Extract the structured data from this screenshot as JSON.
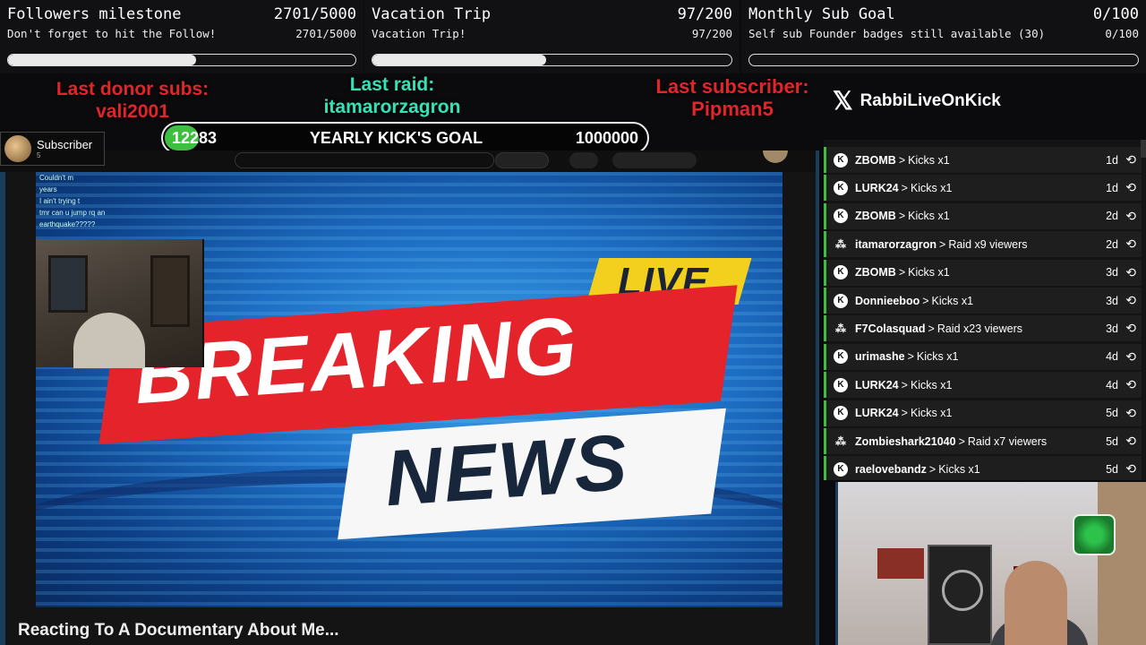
{
  "goals": [
    {
      "title": "Followers milestone",
      "count": "2701/5000",
      "subtitle": "Don't forget to hit the Follow!",
      "sub_count": "2701/5000",
      "progress": 0.54
    },
    {
      "title": "Vacation Trip",
      "count": "97/200",
      "subtitle": "Vacation Trip!",
      "sub_count": "97/200",
      "progress": 0.485
    },
    {
      "title": "Monthly Sub Goal",
      "count": "0/100",
      "subtitle": "Self sub Founder badges still available (30)",
      "sub_count": "0/100",
      "progress": 0.0
    }
  ],
  "last_donor": {
    "label": "Last donor subs:",
    "name": "vali2001"
  },
  "last_raid": {
    "label": "Last raid:",
    "name": "itamarorzagron"
  },
  "last_subscriber": {
    "label": "Last subscriber:",
    "name": "Pipman5"
  },
  "twitter": {
    "icon": "x-logo-icon",
    "handle": "RabbiLiveOnKick"
  },
  "yearly_goal": {
    "current": "12283",
    "label": "YEARLY KICK'S GOAL",
    "target": "1000000",
    "progress": 0.012
  },
  "subscriber_alert": {
    "label": "Subscriber",
    "count": "5"
  },
  "video": {
    "title": "Reacting To A Documentary About Me...",
    "banner_live": "LIVE",
    "banner_breaking": "BREAKING",
    "banner_news": "NEWS",
    "chat_lines": [
      "Couldn't m",
      "years",
      "I ain't trying t",
      "tmr can u jump rq an",
      "earthquake?????"
    ]
  },
  "feed": [
    {
      "name": "ZBOMB",
      "event": "Kicks x1",
      "time": "1d",
      "type": "kick"
    },
    {
      "name": "LURK24",
      "event": "Kicks x1",
      "time": "1d",
      "type": "kick"
    },
    {
      "name": "ZBOMB",
      "event": "Kicks x1",
      "time": "2d",
      "type": "kick"
    },
    {
      "name": "itamarorzagron",
      "event": "Raid x9 viewers",
      "time": "2d",
      "type": "raid"
    },
    {
      "name": "ZBOMB",
      "event": "Kicks x1",
      "time": "3d",
      "type": "kick"
    },
    {
      "name": "Donnieeboo",
      "event": "Kicks x1",
      "time": "3d",
      "type": "kick"
    },
    {
      "name": "F7Colasquad",
      "event": "Raid x23 viewers",
      "time": "3d",
      "type": "raid"
    },
    {
      "name": "urimashe",
      "event": "Kicks x1",
      "time": "4d",
      "type": "kick"
    },
    {
      "name": "LURK24",
      "event": "Kicks x1",
      "time": "4d",
      "type": "kick"
    },
    {
      "name": "LURK24",
      "event": "Kicks x1",
      "time": "5d",
      "type": "kick"
    },
    {
      "name": "Zombieshark21040",
      "event": "Raid x7 viewers",
      "time": "5d",
      "type": "raid"
    },
    {
      "name": "raelovebandz",
      "event": "Kicks x1",
      "time": "5d",
      "type": "kick"
    }
  ],
  "colors": {
    "donor": "#e3252b",
    "raid": "#34e2b8",
    "accent_green": "#3fbf3f"
  }
}
